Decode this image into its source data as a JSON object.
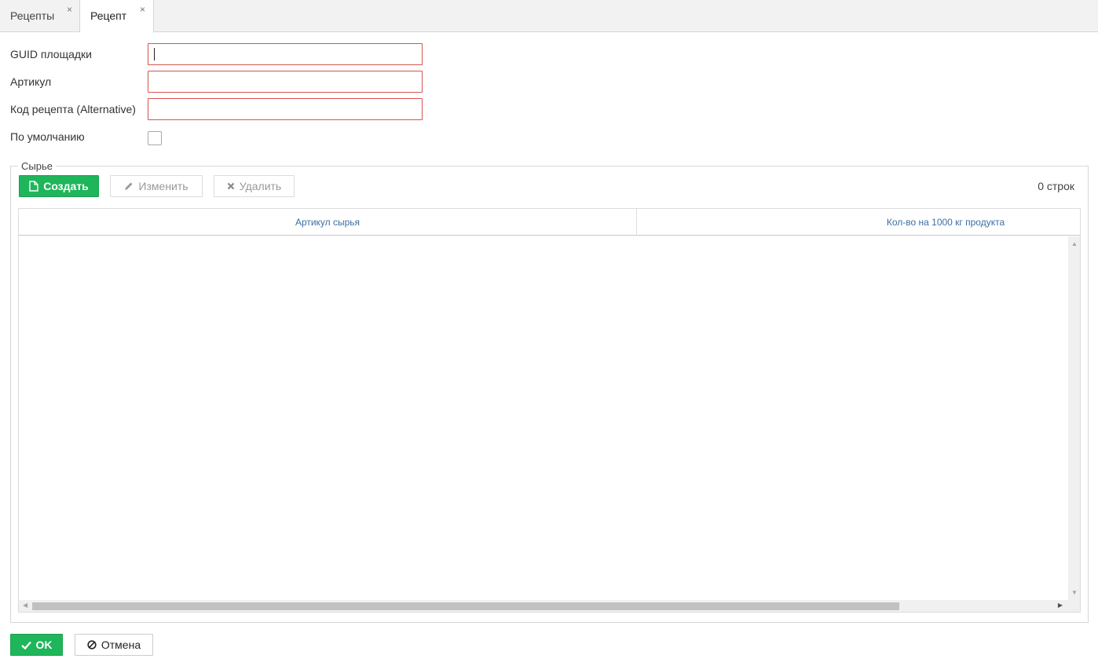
{
  "tabs": [
    {
      "label": "Рецепты",
      "close": "×"
    },
    {
      "label": "Рецепт",
      "close": "×"
    }
  ],
  "form": {
    "guid_label": "GUID площадки",
    "guid_value": "",
    "article_label": "Артикул",
    "article_value": "",
    "code_label": "Код рецепта (Alternative)",
    "code_value": "",
    "default_label": "По умолчанию"
  },
  "raw": {
    "legend": "Сырье",
    "create_label": "Создать",
    "edit_label": "Изменить",
    "delete_label": "Удалить",
    "row_count": "0 строк",
    "columns": [
      "Артикул сырья",
      "Кол-во на 1000 кг продукта"
    ]
  },
  "footer": {
    "ok_label": "OK",
    "cancel_label": "Отмена"
  },
  "colors": {
    "accent_green": "#1fb55a",
    "error_border": "#d9534f",
    "header_text": "#3a6ea5"
  }
}
